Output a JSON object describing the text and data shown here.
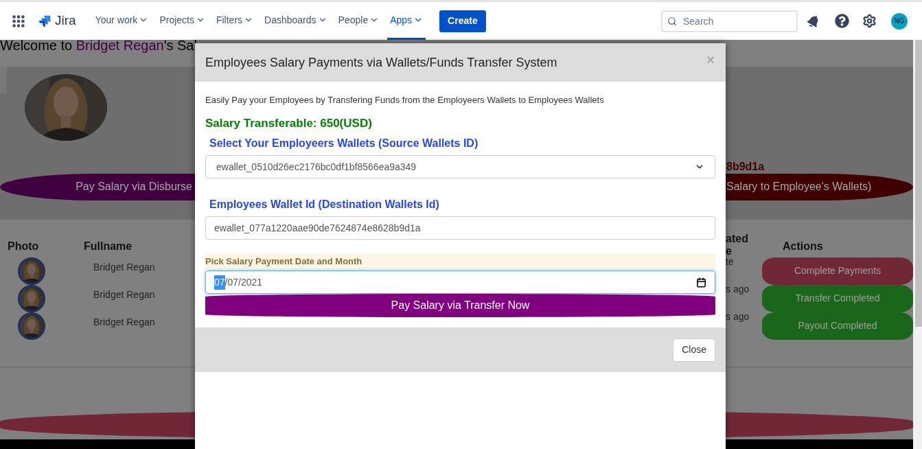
{
  "nav": {
    "logo": "Jira",
    "items": [
      {
        "label": "Your work",
        "selected": false
      },
      {
        "label": "Projects",
        "selected": false
      },
      {
        "label": "Filters",
        "selected": false
      },
      {
        "label": "Dashboards",
        "selected": false
      },
      {
        "label": "People",
        "selected": false
      },
      {
        "label": "Apps",
        "selected": true
      }
    ],
    "create": "Create",
    "search": {
      "placeholder": "Search"
    },
    "avatar": "NG"
  },
  "page": {
    "heading": {
      "prefix": "Welcome to ",
      "name": "Bridget Regan",
      "suffix": "'s Sal"
    },
    "wallet_fragment": "8b9d1a",
    "banner_buttons": [
      {
        "label": "Pay Salary via Disburse",
        "color": "#400040"
      },
      {
        "label": "Salary to Employee's Wallets)",
        "color": "#400000"
      }
    ],
    "table": {
      "columns": [
        "Photo",
        "Fullname",
        "ated\ne",
        "Actions"
      ],
      "rows": [
        {
          "fullname": "Bridget Regan",
          "column_3": "te",
          "action": {
            "label": "Complete Payments",
            "color": "#722737"
          }
        },
        {
          "fullname": "Bridget Regan",
          "column_3": "s ago",
          "action": {
            "label": "Transfer Completed",
            "color": "#1a661a"
          }
        },
        {
          "fullname": "Bridget Regan",
          "column_3": "s ago",
          "action": {
            "label": "Payout Completed",
            "color": "#1a661a"
          }
        }
      ]
    }
  },
  "modal": {
    "title": "Employees Salary Payments via Wallets/Funds Transfer System",
    "close": "×",
    "intro": "Easily Pay your Employees by Transfering Funds from the Employeers Wallets to Employees Wallets",
    "salary": "Salary Transferable: 650(USD)",
    "source_label": "Select Your Employeers Wallets (Source Wallets ID)",
    "source_value": "ewallet_0510d26ec2176bc0df1bf8566ea9a349",
    "destination_label": "Employees Wallet Id (Destination Wallets Id)",
    "destination_value": "ewallet_077a1220aae90de7624874e8628b9d1a",
    "date_label": "Pick Salary Payment Date and Month",
    "date_separator": "/",
    "date_segments": [
      {
        "text": "07",
        "selected": true
      },
      {
        "text": "07",
        "selected": false
      },
      {
        "text": "2021",
        "selected": false
      }
    ],
    "pay_button": "Pay Salary via Transfer Now",
    "footer_button": "Close"
  }
}
